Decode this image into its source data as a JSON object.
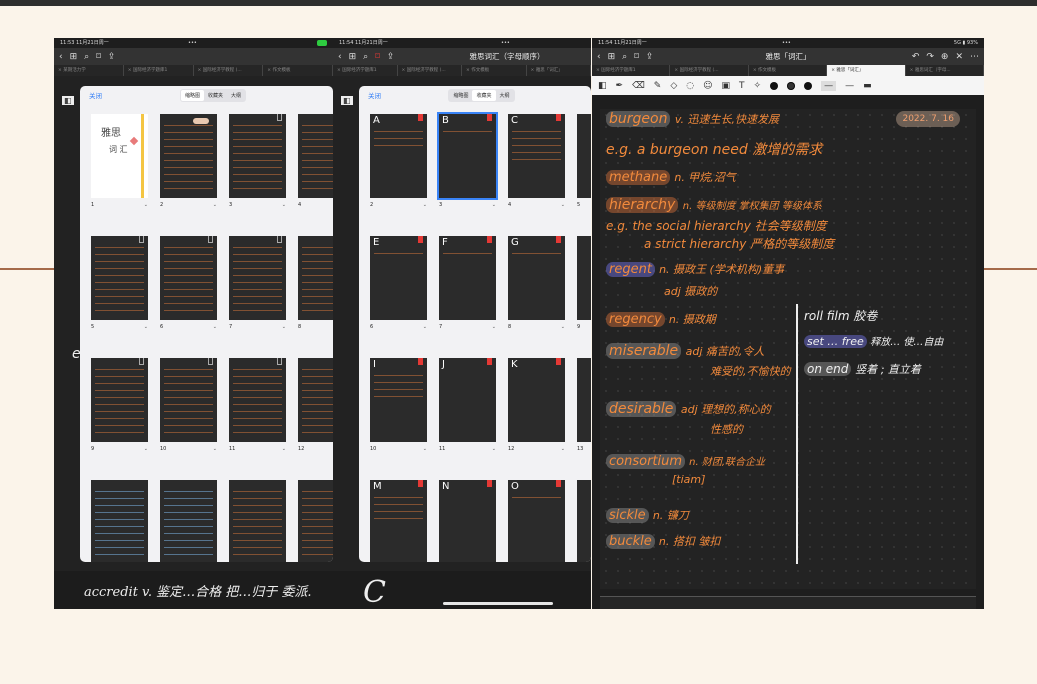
{
  "shot_left": {
    "status_time": "11:53  11月21日周一",
    "status_dots": "•••",
    "tabs": [
      "× 某期活力学",
      "× 国际经济学题库1",
      "× 国际经济学教程 (...",
      "× 作文模板"
    ],
    "panel": {
      "close": "关闭",
      "seg": [
        "缩略图",
        "收藏夹",
        "大纲"
      ]
    },
    "cover_title": "雅思",
    "cover_sub": "词 汇",
    "pages": [
      "1",
      "2",
      "3",
      "4",
      "5",
      "6",
      "7",
      "8",
      "9",
      "10",
      "11",
      "12"
    ],
    "chevron": "⌄",
    "bottom_note": "accredit v. 鉴定…合格  把…归于  委派.",
    "side_letter": "e"
  },
  "shot_mid": {
    "status_time": "11:54  11月21日周一",
    "status_dots": "•••",
    "title": "雅思词汇（字母顺序）",
    "tabs": [
      "× 国际经济学题库1",
      "× 国际经济学教程 (...",
      "× 作文模板",
      "× 雅思「词汇」"
    ],
    "panel": {
      "close": "关闭",
      "seg": [
        "缩略图",
        "收藏夹",
        "大纲"
      ]
    },
    "letters": [
      "A",
      "B",
      "C",
      "",
      "E",
      "F",
      "G",
      "",
      "I",
      "J",
      "K",
      "",
      "M",
      "N",
      "O",
      ""
    ],
    "pages": [
      "2",
      "3",
      "4",
      "5",
      "6",
      "7",
      "8",
      "9",
      "10",
      "11",
      "12",
      "13"
    ],
    "bottom_note": "C"
  },
  "shot_right": {
    "status_time": "11:54  11月21日周一",
    "status_dots": "•••",
    "status_right": "5G ▮ 93%",
    "title": "雅思「词汇」",
    "tabs": [
      "× 国际经济学题库1",
      "× 国际经济学教程 (...",
      "× 作文模板",
      "× 雅思「词汇」",
      "× 雅思词汇（字母..."
    ],
    "date": "2022. 7. 16",
    "notes": {
      "l1a": "burgeon",
      "l1b": "v. 迅速生长,快速发展",
      "l2": "e.g.   a burgeon need 激增的需求",
      "l3a": "methane",
      "l3b": "n. 甲烷,沼气",
      "l4a": "hierarchy",
      "l4b": "n. 等级制度  掌权集团  等级体系",
      "l5": "e.g.  the social hierarchy 社会等级制度",
      "l6": "a strict hierarchy 严格的等级制度",
      "l7a": "regent",
      "l7b": "n. 摄政王  (学术机构)董事",
      "l8": "adj 摄政的",
      "l9a": "regency",
      "l9b": "n. 摄政期",
      "l10a": "miserable",
      "l10b": "adj 痛苦的,令人",
      "l11": "难受的,不愉快的",
      "l12a": "desirable",
      "l12b": "adj 理想的,称心的",
      "l13": "性感的",
      "l14a": "consortium",
      "l14b": "n. 财团,联合企业",
      "l15": "[tiam]",
      "l16a": "sickle",
      "l16b": "n. 镰刀",
      "l17a": "buckle",
      "l17b": "n. 搭扣  皱扣",
      "r1a": "roll film",
      "r1b": "胶卷",
      "r2a": "set … free",
      "r2b": "释放… 使…自由",
      "r3a": "on end",
      "r3b": "竖着 ; 直立着"
    }
  },
  "colors": {
    "accent_orange": "#f28a3c",
    "selection_blue": "#3a84f7",
    "bookmark_red": "#e53935"
  }
}
